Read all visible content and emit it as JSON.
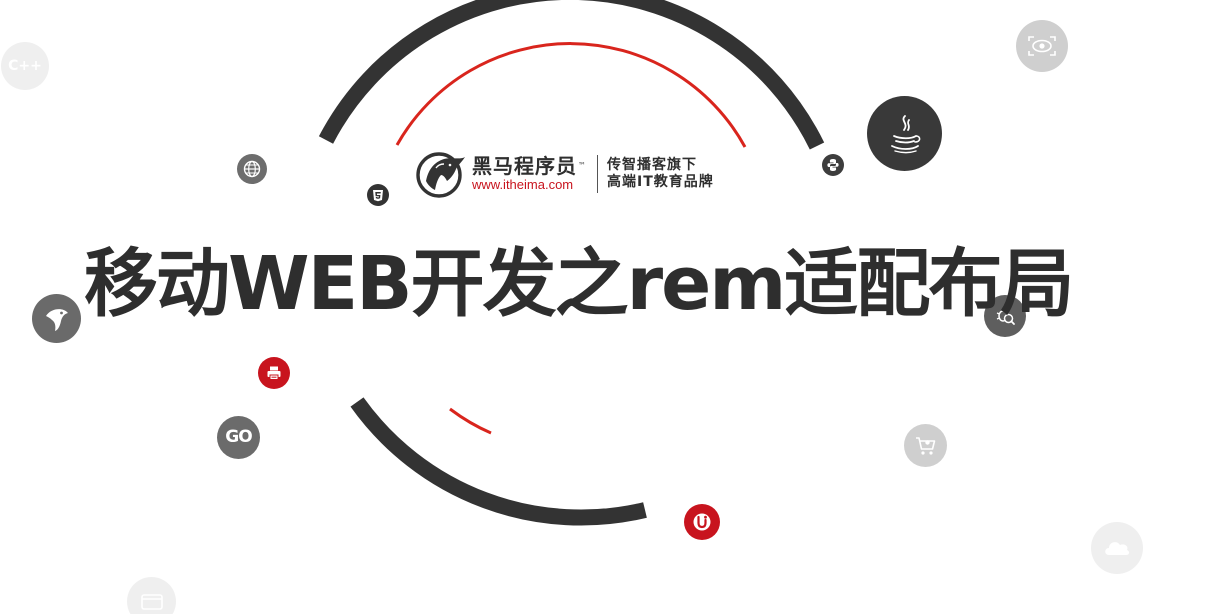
{
  "slide": {
    "title": "移动WEB开发之rem适配布局"
  },
  "logo": {
    "name": "黑马程序员",
    "trademark": "™",
    "url": "www.itheima.com",
    "slogan_line1": "传智播客旗下",
    "slogan_line2": "高端IT教育品牌"
  },
  "icons": {
    "cpp": "C++",
    "go": "GO",
    "names": [
      "cpp-icon",
      "eye-scan-icon",
      "java-icon",
      "python-icon",
      "globe-icon",
      "html5-icon",
      "penguin-icon",
      "bug-search-icon",
      "printer-icon",
      "go-icon",
      "cart-icon",
      "uniapp-icon",
      "cloud-icon",
      "browser-icon"
    ]
  },
  "colors": {
    "dark_arc": "#333333",
    "red_arc": "#d9251d",
    "brand_red": "#c8141e",
    "icon_dark": "#3a3a3a",
    "icon_grey": "#6b6b6b",
    "icon_light": "#d4d4d4",
    "icon_faint": "#eeeeee"
  }
}
